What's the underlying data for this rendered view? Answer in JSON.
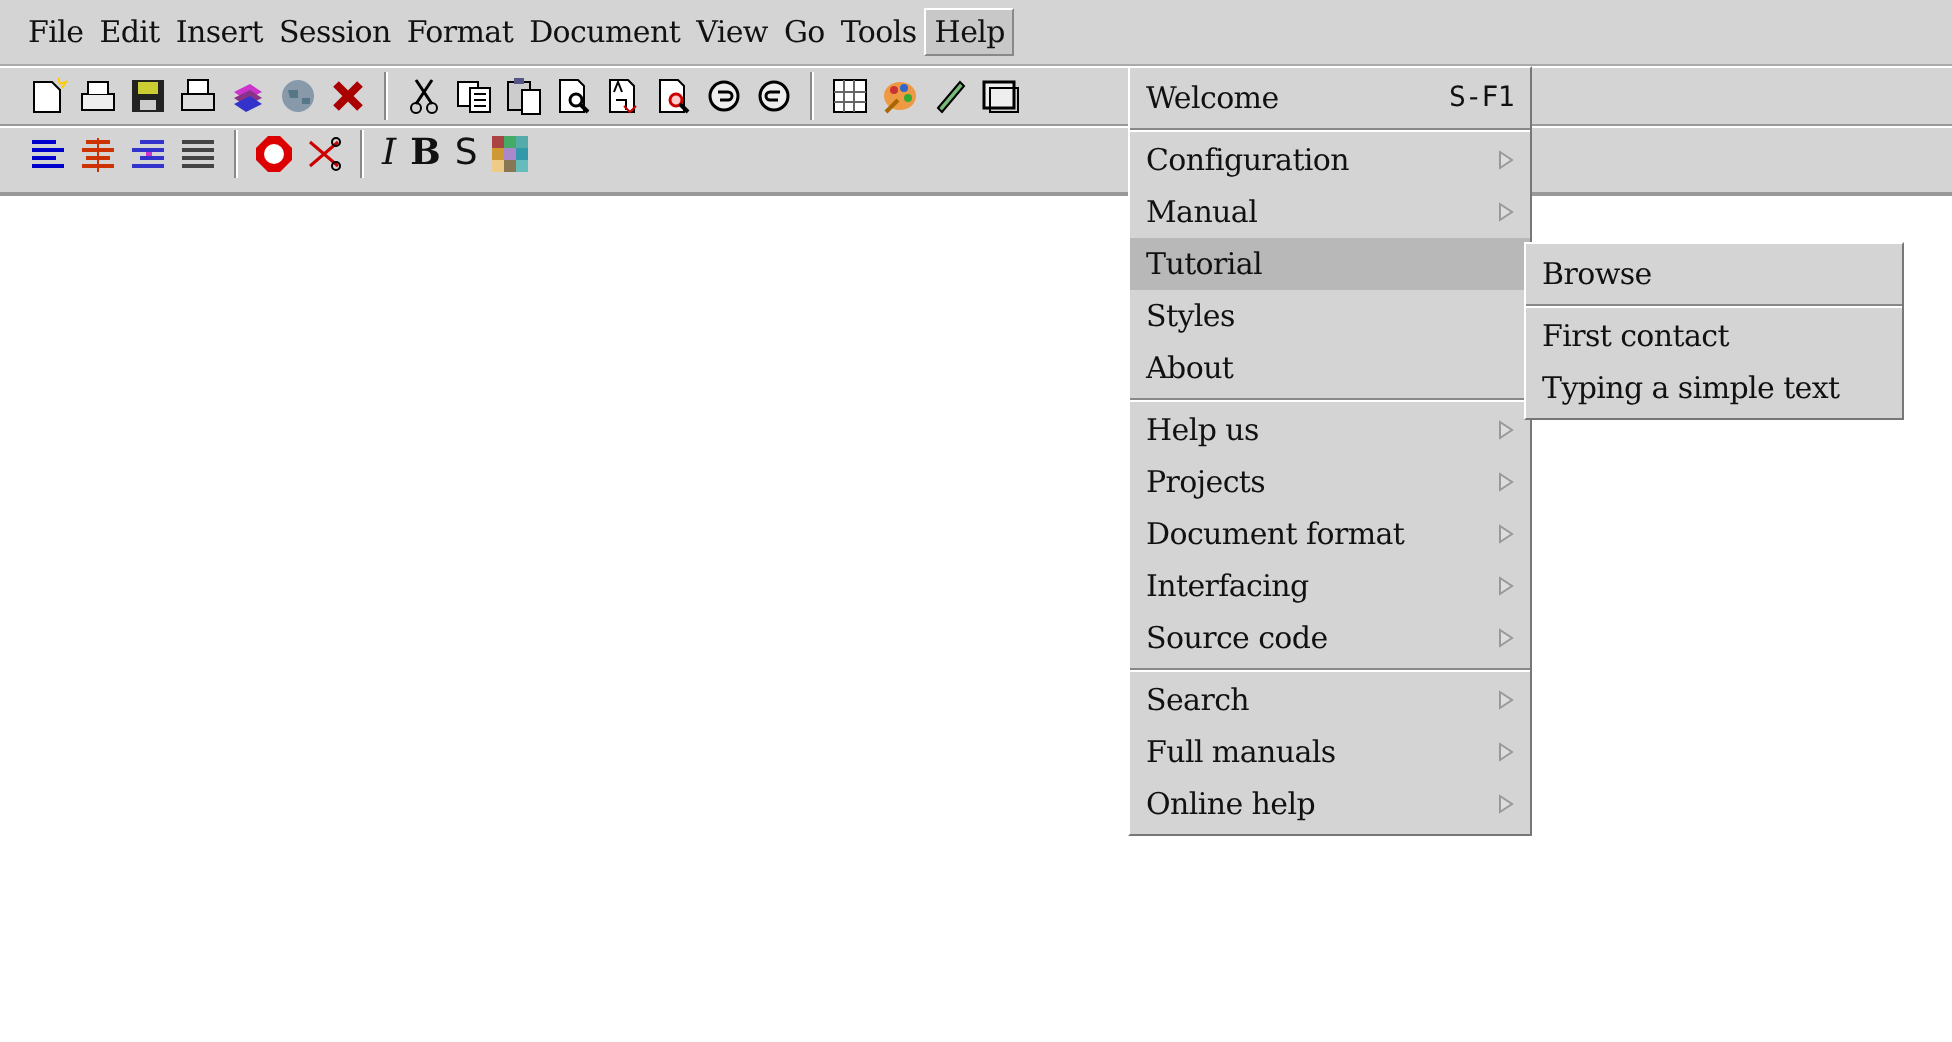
{
  "menubar": [
    {
      "label": "File",
      "selected": false
    },
    {
      "label": "Edit",
      "selected": false
    },
    {
      "label": "Insert",
      "selected": false
    },
    {
      "label": "Session",
      "selected": false
    },
    {
      "label": "Format",
      "selected": false
    },
    {
      "label": "Document",
      "selected": false
    },
    {
      "label": "View",
      "selected": false
    },
    {
      "label": "Go",
      "selected": false
    },
    {
      "label": "Tools",
      "selected": false
    },
    {
      "label": "Help",
      "selected": true
    }
  ],
  "format_toolbar": {
    "style_buttons": [
      {
        "label": "I",
        "kind": "italic"
      },
      {
        "label": "B",
        "kind": "bold"
      },
      {
        "label": "S",
        "kind": "sans"
      }
    ]
  },
  "help_menu": {
    "sections": [
      [
        {
          "label": "Welcome",
          "shortcut": "S-F1",
          "submenu": false,
          "selected": false
        }
      ],
      [
        {
          "label": "Configuration",
          "submenu": true,
          "selected": false
        },
        {
          "label": "Manual",
          "submenu": true,
          "selected": false
        },
        {
          "label": "Tutorial",
          "submenu": false,
          "selected": true
        },
        {
          "label": "Styles",
          "submenu": false,
          "selected": false
        },
        {
          "label": "About",
          "submenu": false,
          "selected": false
        }
      ],
      [
        {
          "label": "Help us",
          "submenu": true,
          "selected": false
        },
        {
          "label": "Projects",
          "submenu": true,
          "selected": false
        },
        {
          "label": "Document format",
          "submenu": true,
          "selected": false
        },
        {
          "label": "Interfacing",
          "submenu": true,
          "selected": false
        },
        {
          "label": "Source code",
          "submenu": true,
          "selected": false
        }
      ],
      [
        {
          "label": "Search",
          "submenu": true,
          "selected": false
        },
        {
          "label": "Full manuals",
          "submenu": true,
          "selected": false
        },
        {
          "label": "Online help",
          "submenu": true,
          "selected": false
        }
      ]
    ]
  },
  "tutorial_submenu": {
    "sections": [
      [
        {
          "label": "Browse"
        }
      ],
      [
        {
          "label": "First contact"
        },
        {
          "label": "Typing a simple text"
        }
      ]
    ]
  }
}
